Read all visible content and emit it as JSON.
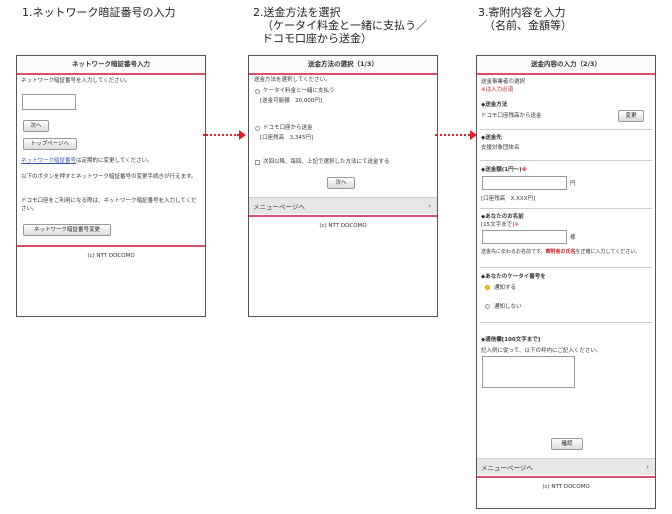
{
  "steps": [
    {
      "title": "1.ネットワーク暗証番号の入力"
    },
    {
      "title": "2.送金方法を選択",
      "sub1": "（ケータイ料金と一緒に支払う／",
      "sub2": "ドコモ口座から送金）"
    },
    {
      "title": "3.寄附内容を入力",
      "sub1": "（名前、金額等）"
    }
  ],
  "screen1": {
    "header": "ネットワーク暗証番号入力",
    "instruction": "ネットワーク暗証番号を入力してください。",
    "next_button": "次へ",
    "top_button": "トップページへ",
    "link_text": "ネットワーク暗証番号",
    "link_suffix": "は定期的に変更してください。",
    "note1": "以下のボタンを押すとネットワーク暗証番号の変更手続きが行えます。",
    "note2": "ドコモ口座をご利用になる際は、ネットワーク暗証番号を入力してください。",
    "change_button": "ネットワーク暗証番号変更",
    "footer": "(c) NTT DOCOMO"
  },
  "screen2": {
    "header": "送金方法の選択（1/3）",
    "instruction": "送金方法を選択してください。",
    "option1_label": "ケータイ料金と一緒に支払う",
    "option1_detail": "[送金可能額　20,000円]",
    "option2_label": "ドコモ口座から送金",
    "option2_detail": "[口座残高　3,345円]",
    "remember_label": "次回以降、毎回、上記で選択した方法にて送金する",
    "next_button": "次へ",
    "menu_label": "メニューページへ",
    "menu_chevron": "›",
    "footer": "(c) NTT DOCOMO"
  },
  "screen3": {
    "header": "送金内容の入力（2/3）",
    "recipient_title": "送金事業者の選択",
    "required_note": "※は入力必須",
    "method_title": "◆送金方法",
    "method_value": "ドコモ口座残高から送金",
    "change_button": "変更",
    "dest_title": "◆送金先",
    "dest_value": "支援対象団体名",
    "amount_title": "◆送金額(1円～)",
    "required_mark": "※",
    "amount_unit": "円",
    "balance_text": "[口座残高　X,XXX円]",
    "name_title": "◆あなたのお名前",
    "name_limit": "[15文字まで]",
    "name_suffix": "様",
    "name_note_prefix": "送金先に伝わるお名前です。",
    "name_note_red": "寄附者の氏名",
    "name_note_suffix": "を正確に入力してください。",
    "phone_title": "◆あなたのケータイ番号を",
    "notify_yes": "通知する",
    "notify_no": "通知しない",
    "message_title": "◆通信欄[100文字まで]",
    "message_note": "記入例に従って、以下の枠内にご記入ください。",
    "confirm_button": "確認",
    "menu_label": "メニューページへ",
    "menu_chevron": "›",
    "footer": "(c) NTT DOCOMO"
  }
}
